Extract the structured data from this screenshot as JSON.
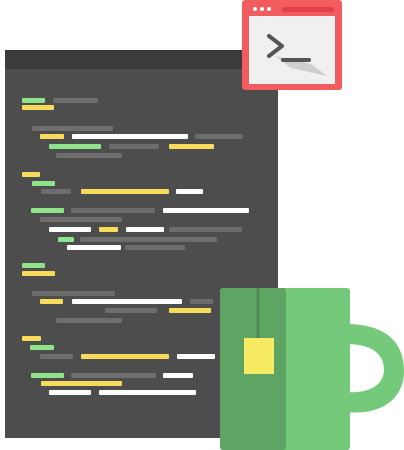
{
  "illustration": {
    "subject": "code-editor-with-tea-mug",
    "colors": {
      "editor_background": "#4d4d4d",
      "editor_header": "#3b3b3b",
      "code_green": "#8fe38a",
      "code_yellow": "#f7dc5b",
      "code_white": "#ffffff",
      "code_gray": "#6d6d6d",
      "terminal_frame": "#f25c5f",
      "terminal_body": "#f0f0f0",
      "terminal_prompt": "#555555",
      "mug_light": "#75c97a",
      "mug_dark": "#5ea564",
      "tea_tag": "#f5ea62"
    },
    "icons": {
      "terminal": "terminal-window-icon",
      "prompt": "prompt-chevron-icon",
      "mug": "tea-mug-icon",
      "tea_tag": "tea-bag-tag-icon"
    }
  }
}
